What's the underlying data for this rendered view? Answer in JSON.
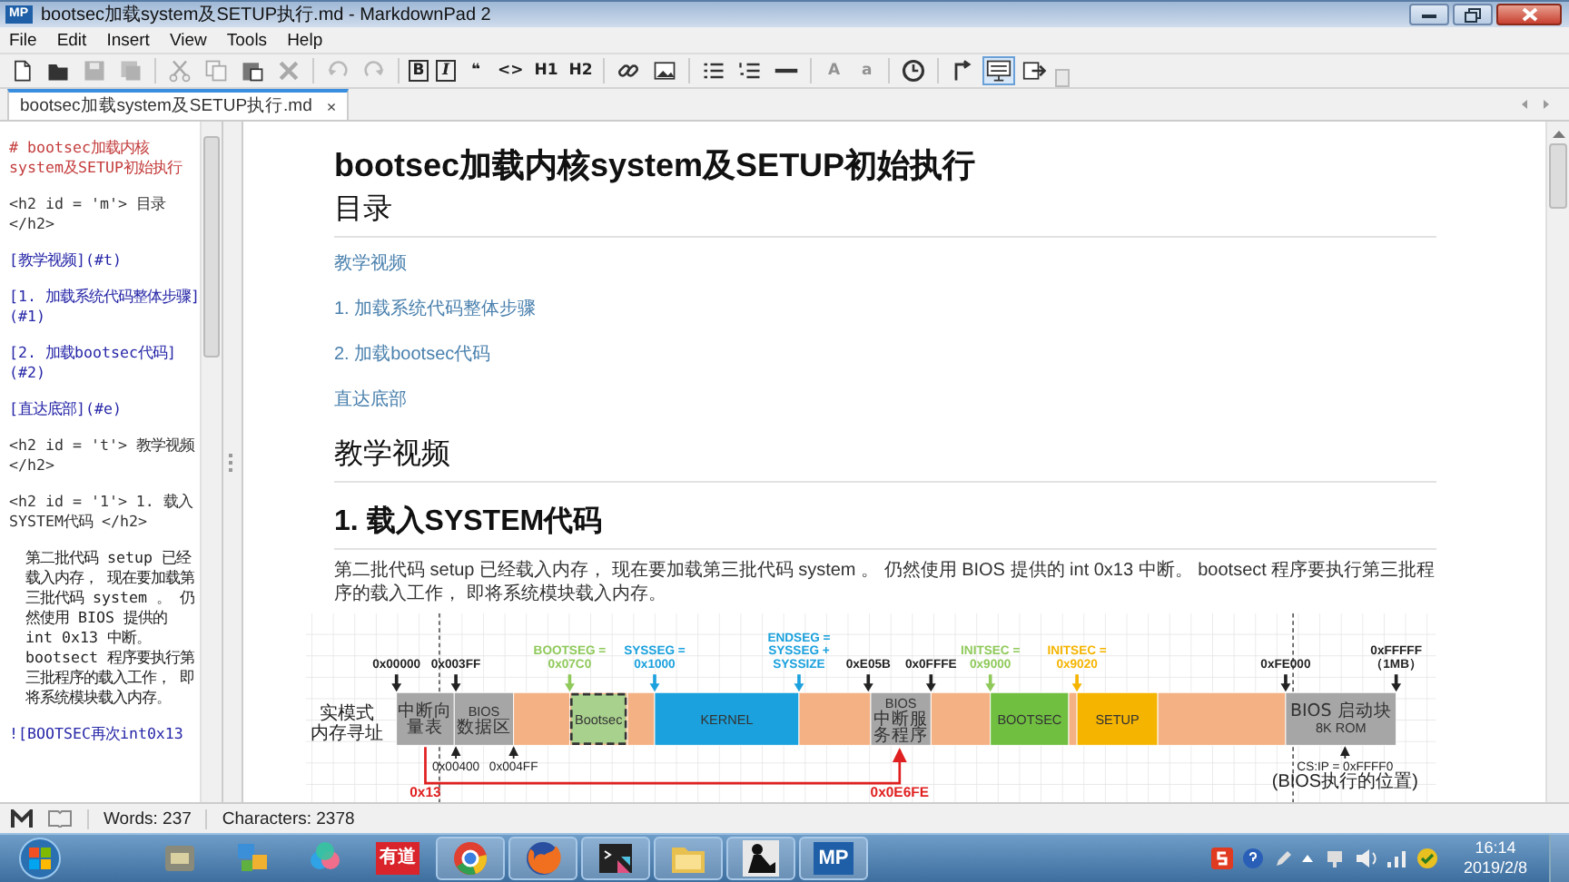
{
  "window": {
    "title": "bootsec加载system及SETUP执行.md - MarkdownPad 2",
    "app_badge": "MP"
  },
  "menu": [
    "File",
    "Edit",
    "Insert",
    "View",
    "Tools",
    "Help"
  ],
  "toolbar": [
    {
      "kind": "icon",
      "disabled": false,
      "selected": false
    },
    {
      "kind": "icon",
      "disabled": false,
      "selected": false
    },
    {
      "kind": "icon",
      "disabled": true,
      "selected": false
    },
    {
      "kind": "icon",
      "disabled": true,
      "selected": false
    },
    {
      "kind": "separator"
    },
    {
      "kind": "icon",
      "disabled": true,
      "selected": false
    },
    {
      "kind": "icon",
      "disabled": true,
      "selected": false
    },
    {
      "kind": "icon",
      "disabled": false,
      "selected": false
    },
    {
      "kind": "icon",
      "disabled": true,
      "selected": false
    },
    {
      "kind": "separator"
    },
    {
      "kind": "icon",
      "disabled": true,
      "selected": false
    },
    {
      "kind": "icon",
      "disabled": true,
      "selected": false
    },
    {
      "kind": "separator"
    },
    {
      "kind": "text",
      "label": "B",
      "boxed": true,
      "disabled": false,
      "selected": false
    },
    {
      "kind": "text",
      "label": "I",
      "boxed": true,
      "disabled": false,
      "selected": false
    },
    {
      "kind": "text",
      "label": "❝",
      "boxed": false,
      "disabled": false,
      "selected": false
    },
    {
      "kind": "text",
      "label": "<>",
      "boxed": false,
      "disabled": false,
      "selected": false
    },
    {
      "kind": "text",
      "label": "H1",
      "boxed": false,
      "disabled": false,
      "selected": false
    },
    {
      "kind": "text",
      "label": "H2",
      "boxed": false,
      "disabled": false,
      "selected": false
    },
    {
      "kind": "separator"
    },
    {
      "kind": "icon",
      "disabled": false,
      "selected": false
    },
    {
      "kind": "icon",
      "disabled": false,
      "selected": false
    },
    {
      "kind": "separator"
    },
    {
      "kind": "icon",
      "disabled": false,
      "selected": false
    },
    {
      "kind": "icon",
      "disabled": false,
      "selected": false
    },
    {
      "kind": "icon",
      "disabled": false,
      "selected": false
    },
    {
      "kind": "separator"
    },
    {
      "kind": "text",
      "label": "A",
      "boxed": false,
      "disabled": true,
      "selected": false
    },
    {
      "kind": "text",
      "label": "a",
      "boxed": false,
      "disabled": true,
      "selected": false
    },
    {
      "kind": "separator"
    },
    {
      "kind": "icon",
      "disabled": false,
      "selected": false
    },
    {
      "kind": "separator"
    },
    {
      "kind": "icon",
      "disabled": false,
      "selected": false
    },
    {
      "kind": "icon",
      "disabled": false,
      "selected": true
    },
    {
      "kind": "icon",
      "disabled": false,
      "selected": false
    }
  ],
  "tabs": [
    {
      "label": "bootsec加载system及SETUP执行.md",
      "close": "×",
      "selected": true
    }
  ],
  "editor": [
    {
      "kind": "heading",
      "text": "# bootsec加载内核system及SETUP初始执行"
    },
    {
      "kind": "html",
      "text": "<h2 id = 'm'> 目录 </h2>"
    },
    {
      "kind": "link",
      "text": "[教学视频](#t)"
    },
    {
      "kind": "link",
      "text": "[1. 加载系统代码整体步骤](#1)"
    },
    {
      "kind": "link",
      "text": "[2. 加载bootsec代码](#2)"
    },
    {
      "kind": "link",
      "text": "[直达底部](#e)"
    },
    {
      "kind": "html",
      "text": "<h2 id = 't'> 教学视频 </h2>"
    },
    {
      "kind": "html",
      "text": "<h2 id = '1'> 1. 载入SYSTEM代码 </h2>"
    },
    {
      "kind": "text",
      "text": "第二批代码 setup 已经载入内存， 现在要加载第三批代码 system 。 仍然使用 BIOS 提供的 int 0x13 中断。 bootsect 程序要执行第三批程序的载入工作， 即将系统模块载入内存。"
    },
    {
      "kind": "link",
      "text": "![BOOTSEC再次int0x13"
    }
  ],
  "preview": {
    "title": "bootsec加载内核system及SETUP初始执行",
    "toc_heading": "目录",
    "toc": [
      "教学视频",
      "1. 加载系统代码整体步骤",
      "2. 加载bootsec代码",
      "直达底部"
    ],
    "video_heading": "教学视频",
    "section_heading": "1. 载入SYSTEM代码",
    "paragraph": "第二批代码 setup 已经载入内存， 现在要加载第三批代码 system 。 仍然使用 BIOS 提供的 int 0x13 中断。 bootsect 程序要执行第三批程序的载入工作， 即将系统模块载入内存。",
    "diagram": {
      "row_label": [
        "实模式",
        "内存寻址"
      ],
      "segments": [
        {
          "lines": [
            "中断向",
            "量表"
          ],
          "color": "#a6a6a6",
          "dashed": false
        },
        {
          "lines": [
            "BIOS",
            "数据区"
          ],
          "color": "#a6a6a6",
          "dashed": false
        },
        {
          "color": "#f4b183",
          "dashed": false
        },
        {
          "lines": [
            "Bootsec"
          ],
          "color": "#a9d18e",
          "dashed": true
        },
        {
          "color": "#f4b183",
          "dashed": false
        },
        {
          "lines": [
            "KERNEL"
          ],
          "color": "#1ba1dd",
          "dashed": false
        },
        {
          "color": "#f4b183",
          "dashed": false
        },
        {
          "lines": [
            "BIOS",
            "中断服",
            "务程序"
          ],
          "color": "#a6a6a6",
          "dashed": false
        },
        {
          "color": "#f4b183",
          "dashed": false
        },
        {
          "lines": [
            "BOOTSEC"
          ],
          "color": "#70bf41",
          "dashed": false
        },
        {
          "color": "#f4b183",
          "dashed": false
        },
        {
          "lines": [
            "SETUP"
          ],
          "color": "#f5b400",
          "dashed": false
        },
        {
          "color": "#f4b183",
          "dashed": false
        },
        {
          "lines": [
            "BIOS 启动块",
            "8K ROM"
          ],
          "color": "#a6a6a6",
          "dashed": false
        }
      ],
      "top_markers": [
        {
          "lines": [
            "0x00000"
          ],
          "color": "#222222"
        },
        {
          "lines": [
            "0x003FF"
          ],
          "color": "#222222"
        },
        {
          "lines": [
            "BOOTSEG =",
            "0x07C0"
          ],
          "color": "#8fc95a"
        },
        {
          "lines": [
            "SYSSEG =",
            "0x1000"
          ],
          "color": "#1ba1dd"
        },
        {
          "lines": [
            "ENDSEG =",
            "SYSSEG +",
            "SYSSIZE"
          ],
          "color": "#1ba1dd"
        },
        {
          "lines": [
            "0xE05B"
          ],
          "color": "#222222"
        },
        {
          "lines": [
            "0x0FFFE"
          ],
          "color": "#222222"
        },
        {
          "lines": [
            "INITSEC =",
            "0x9000"
          ],
          "color": "#8fc95a"
        },
        {
          "lines": [
            "INITSEC =",
            "0x9020"
          ],
          "color": "#f5b400"
        },
        {
          "lines": [
            "0xFE000"
          ],
          "color": "#222222"
        },
        {
          "lines": [
            "0xFFFFF",
            "（1MB）"
          ],
          "color": "#222222"
        }
      ],
      "bottom_markers": [
        {
          "lines": [
            "0x00400"
          ]
        },
        {
          "lines": [
            "0x004FF"
          ]
        },
        {
          "lines": [
            "CS:IP = 0xFFFF0",
            "(BIOS执行的位置)"
          ]
        }
      ],
      "jump": {
        "from": "0x13",
        "to": "0x0E6FE"
      }
    }
  },
  "status_bar": {
    "words": "Words: 237",
    "characters": "Characters: 2378"
  },
  "taskbar": {
    "apps": [
      {
        "kind": "icon",
        "running": false
      },
      {
        "kind": "icon",
        "running": false
      },
      {
        "kind": "icon",
        "running": false
      },
      {
        "kind": "text",
        "label": "有道",
        "running": false
      },
      {
        "kind": "icon",
        "running": true
      },
      {
        "kind": "icon",
        "running": true
      },
      {
        "kind": "icon",
        "running": true
      },
      {
        "kind": "icon",
        "running": true
      },
      {
        "kind": "icon",
        "running": true
      },
      {
        "kind": "text",
        "label": "MP",
        "running": true
      }
    ],
    "time": "16:14",
    "date": "2019/2/8"
  }
}
